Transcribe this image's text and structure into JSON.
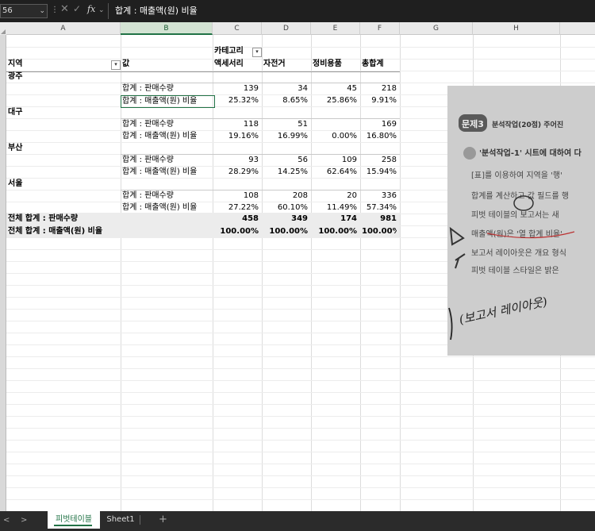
{
  "formula_bar": {
    "name_box": "56",
    "formula": "합계 : 매출액(원) 비율"
  },
  "columns": [
    "A",
    "B",
    "C",
    "D",
    "E",
    "F",
    "G",
    "H"
  ],
  "pivot": {
    "category_field": "카테고리",
    "row_field": "지역",
    "values_field": "값",
    "col_headers": [
      "액세서리",
      "자전거",
      "정비용품",
      "총합계"
    ],
    "measure_labels": [
      "합계 : 판매수량",
      "합계 : 매출액(원) 비율"
    ],
    "regions": [
      {
        "name": "광주",
        "qty": [
          "139",
          "34",
          "45",
          "218"
        ],
        "pct": [
          "25.32%",
          "8.65%",
          "25.86%",
          "9.91%"
        ]
      },
      {
        "name": "대구",
        "qty": [
          "118",
          "51",
          "",
          "169"
        ],
        "pct": [
          "19.16%",
          "16.99%",
          "0.00%",
          "16.80%"
        ]
      },
      {
        "name": "부산",
        "qty": [
          "93",
          "56",
          "109",
          "258"
        ],
        "pct": [
          "28.29%",
          "14.25%",
          "62.64%",
          "15.94%"
        ]
      },
      {
        "name": "서울",
        "qty": [
          "108",
          "208",
          "20",
          "336"
        ],
        "pct": [
          "27.22%",
          "60.10%",
          "11.49%",
          "57.34%"
        ]
      }
    ],
    "grand_total_qty": {
      "label": "전체 합계 : 판매수량",
      "values": [
        "458",
        "349",
        "174",
        "981"
      ]
    },
    "grand_total_pct": {
      "label": "전체 합계 : 매출액(원) 비율",
      "values": [
        "100.00%",
        "100.00%",
        "100.00%",
        "100.00%"
      ]
    }
  },
  "photo": {
    "badge": "문제3",
    "header": "분석작업(20점)  주어진",
    "lines": [
      "'분석작업-1' 시트에 대하여 다",
      "[표]를 이용하여 지역을 '행'",
      "합계를 계산하고 값 필드를 행",
      "피벗 테이블의 보고서는 새",
      "매출액(원)은 '열 합계 비율'",
      "보고서 레이아웃은 개요 형식",
      "피벗 테이블 스타일은 밝은"
    ],
    "handwriting": "(보고서 레이아웃)"
  },
  "sheet_tabs": {
    "active": "피벗테이블",
    "other": "Sheet1",
    "add": "+"
  },
  "colors": {
    "accent": "#217346",
    "header_bg": "#e9e9e9",
    "total_band": "#ececec"
  }
}
